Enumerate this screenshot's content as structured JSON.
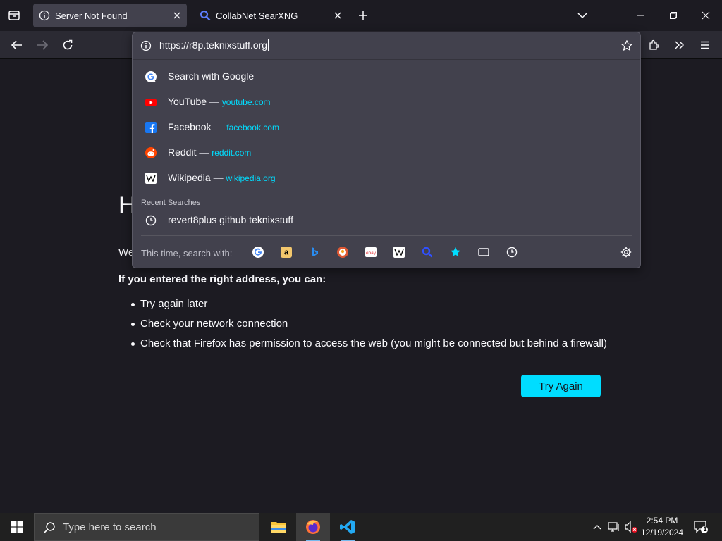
{
  "tabs": [
    {
      "title": "Server Not Found",
      "active": true,
      "icon": "info-icon"
    },
    {
      "title": "CollabNet SearXNG",
      "active": false,
      "icon": "magnifier-icon"
    }
  ],
  "urlbar": {
    "value": "https://r8p.teknixstuff.org",
    "suggestions": [
      {
        "label": "Search with Google",
        "url": "",
        "icon": "google-icon"
      },
      {
        "label": "YouTube",
        "url": "youtube.com",
        "icon": "youtube-icon"
      },
      {
        "label": "Facebook",
        "url": "facebook.com",
        "icon": "facebook-icon"
      },
      {
        "label": "Reddit",
        "url": "reddit.com",
        "icon": "reddit-icon"
      },
      {
        "label": "Wikipedia",
        "url": "wikipedia.org",
        "icon": "wikipedia-icon"
      }
    ],
    "separator": "—",
    "recent_label": "Recent Searches",
    "recent": [
      {
        "label": "revert8plus github teknixstuff",
        "icon": "history-clock-icon"
      }
    ],
    "oneoff_label": "This time, search with:",
    "oneoff_engines": [
      "google-icon",
      "amazon-icon",
      "bing-icon",
      "duckduckgo-icon",
      "ebay-icon",
      "wikipedia-icon",
      "searxng-icon",
      "bookmarks-star-icon",
      "tabs-icon",
      "history-icon"
    ]
  },
  "page": {
    "heading_partial": "H",
    "line_partial": "We",
    "intro": "If you entered the right address, you can:",
    "suggestions": [
      "Try again later",
      "Check your network connection",
      "Check that Firefox has permission to access the web (you might be connected but behind a firewall)"
    ],
    "try_again_label": "Try Again"
  },
  "taskbar": {
    "search_placeholder": "Type here to search",
    "time": "2:54 PM",
    "date": "12/19/2024",
    "notification_count": "1"
  },
  "colors": {
    "accent": "#00ddff",
    "page_bg": "#1c1b22",
    "toolbar_bg": "#2b2a33",
    "panel_bg": "#42414d"
  }
}
